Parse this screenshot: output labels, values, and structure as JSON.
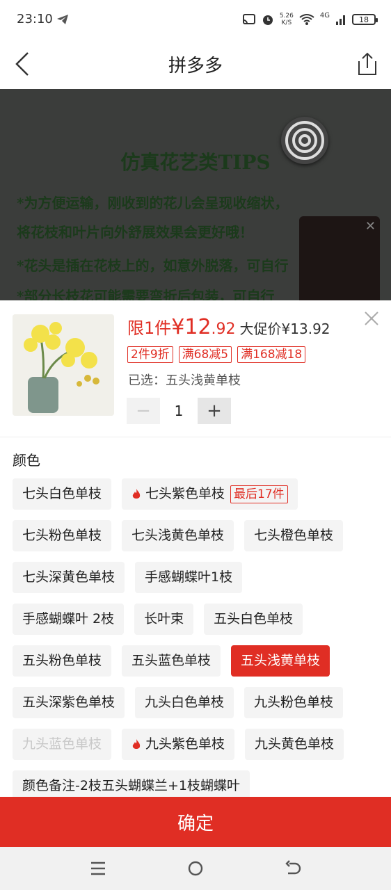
{
  "status_bar": {
    "time": "23:10",
    "net_speed_value": "5.26",
    "net_speed_unit": "K/S",
    "network": "4G",
    "battery": "18",
    "icons": [
      "telegram-icon",
      "cast-icon",
      "alarm-icon",
      "wifi-icon",
      "signal-icon",
      "battery-icon"
    ]
  },
  "nav": {
    "title": "拼多多"
  },
  "product_image": {
    "tips_title": "仿真花艺类TIPS",
    "tips_lines": [
      "*为方便运输，刚收到的花儿会呈现收缩状，",
      " 将花枝和叶片向外舒展效果会更好哦！",
      "*花头是插在花枝上的，如意外脱落，可自行",
      "*部分长枝花可能需要弯折后包装，可自行"
    ]
  },
  "sku": {
    "price_limit": "限1件",
    "price_integer": "¥12",
    "price_decimal": ".92",
    "promo_price": "大促价¥13.92",
    "coupons": [
      "2件9折",
      "满68减5",
      "满168减18"
    ],
    "selected_prefix": "已选：",
    "selected_value": "五头浅黄单枝",
    "quantity": "1",
    "minus": "−",
    "plus": "+",
    "section_label": "颜色",
    "low_stock_tag": "最后17件",
    "options": [
      [
        "七头白色单枝",
        "七头紫色单枝"
      ],
      [
        "七头粉色单枝",
        "七头浅黄色单枝",
        "七头橙色单枝"
      ],
      [
        "七头深黄色单枝",
        "手感蝴蝶叶1枝"
      ],
      [
        "手感蝴蝶叶 2枝",
        "长叶束",
        "五头白色单枝"
      ],
      [
        "五头粉色单枝",
        "五头蓝色单枝",
        "五头浅黄单枝"
      ],
      [
        "五头深紫色单枝",
        "九头白色单枝",
        "九头粉色单枝"
      ],
      [
        "九头蓝色单枝",
        "九头紫色单枝",
        "九头黄色单枝"
      ],
      [
        "颜色备注-2枝五头蝴蝶兰+1枝蝴蝶叶"
      ]
    ],
    "selected_option": "五头浅黄单枝",
    "disabled_option": "九头蓝色单枝",
    "hot_options": [
      "七头紫色单枝",
      "九头紫色单枝"
    ]
  },
  "confirm_label": "确定",
  "colors": {
    "accent": "#e02e24",
    "chip_bg": "#f4f4f4"
  }
}
